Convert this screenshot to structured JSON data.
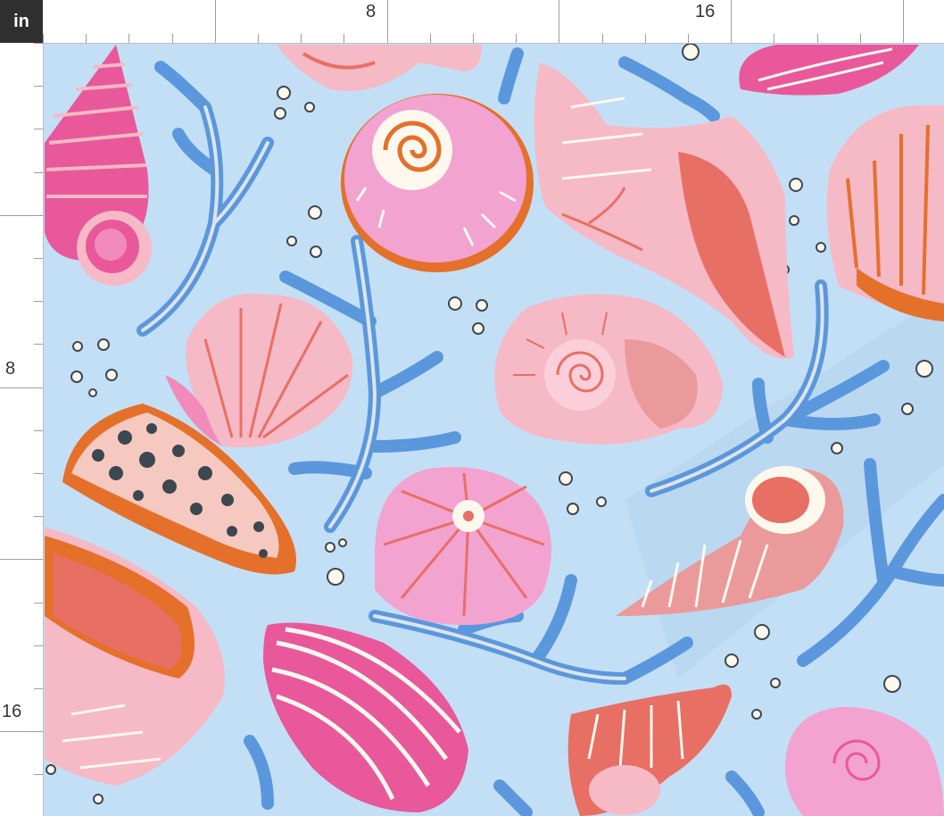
{
  "unit_label": "in",
  "ruler": {
    "top_labels": [
      "8",
      "16"
    ],
    "left_labels": [
      "8",
      "16"
    ]
  },
  "palette": {
    "background": "#c3dff6",
    "pink_light": "#f6b9c6",
    "pink_hot": "#e9589a",
    "coral": "#e86f64",
    "orange": "#e4702a",
    "blue_coral": "#5b97dc",
    "cream": "#fdf8ee",
    "dark_dots": "#3d4750"
  },
  "pattern": {
    "name": "seashells",
    "motifs": [
      "spiral-shell-icon",
      "scallop-shell-icon",
      "conch-shell-icon",
      "cone-shell-icon",
      "mussel-shell-icon",
      "sea-urchin-icon",
      "coral-branch-icon",
      "bubble-icon"
    ]
  }
}
